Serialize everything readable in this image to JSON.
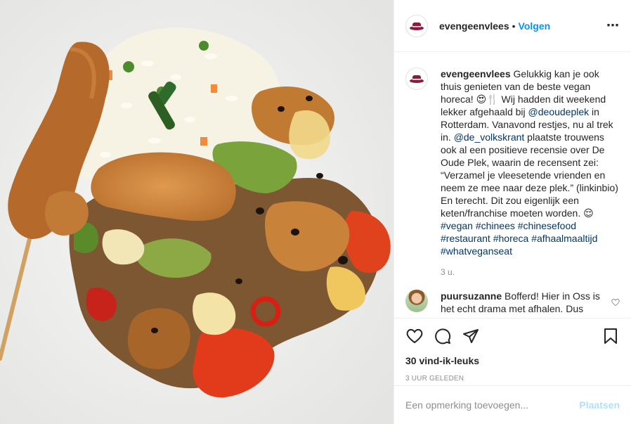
{
  "post": {
    "username": "evengeenvlees",
    "follow_label": "Volgen",
    "more_icon": "more-options-icon",
    "caption_author": "evengeenvlees",
    "caption_parts": {
      "p1": " Gelukkig kan je ook thuis genieten van de beste vegan horeca! 😍🍴 Wij hadden dit weekend lekker afgehaald bij ",
      "mention1": "@deoudeplek",
      "p2": " in Rotterdam. Vanavond restjes, nu al trek in. ",
      "mention2": "@de_volkskrant",
      "p3": " plaatste trouwens ook al een positieve recensie over De Oude Plek, waarin de recensent zei: “Verzamel je vleesetende vrienden en neem ze mee naar deze plek.” (linkinbio) En terecht. Dit zou eigenlijk een keten/franchise moeten worden. 😌 ",
      "hashtags": "#vegan #chinees #chinesefood #restaurant #horeca #afhaalmaaltijd #whatveganseat"
    },
    "caption_time": "3 u.",
    "comment": {
      "username": "puursuzanne",
      "text": " Bofferd! Hier in Oss is het echt drama met afhalen. Dus"
    },
    "likes": "30 vind-ik-leuks",
    "posted_ago": "3 UUR GELEDEN",
    "comment_placeholder": "Een opmerking toevoegen...",
    "post_label": "Plaatsen"
  },
  "colors": {
    "link": "#0095f6",
    "mention": "#00376b",
    "brand_avatar": "#8a1c3a",
    "muted": "#8e8e8e"
  }
}
